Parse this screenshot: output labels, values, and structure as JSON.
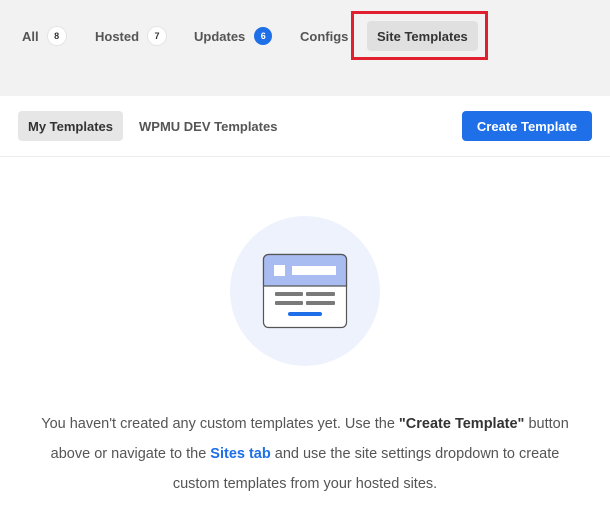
{
  "top_tabs": {
    "all": {
      "label": "All",
      "count": "8"
    },
    "hosted": {
      "label": "Hosted",
      "count": "7"
    },
    "updates": {
      "label": "Updates",
      "count": "6"
    },
    "configs": {
      "label": "Configs"
    },
    "site_templates": {
      "label": "Site Templates"
    }
  },
  "sub_tabs": {
    "my_templates": {
      "label": "My Templates"
    },
    "wpmu_dev_templates": {
      "label": "WPMU DEV Templates"
    }
  },
  "create_button": {
    "label": "Create Template"
  },
  "empty_state": {
    "icon": "site-template-icon",
    "line1_prefix": "You haven't created any custom templates yet. Use the ",
    "line1_emphasis": "\"Create Template\"",
    "line1_suffix": " button",
    "line2_prefix": "above or navigate to the ",
    "line2_link": "Sites tab",
    "line2_suffix": " and use the site settings dropdown to create",
    "line3": "custom templates from your hosted sites."
  },
  "colors": {
    "accent": "#1e6fe8",
    "highlight": "#e0202e",
    "header_bg": "#f2f2f2",
    "illustration_bg": "#edf2fd"
  }
}
